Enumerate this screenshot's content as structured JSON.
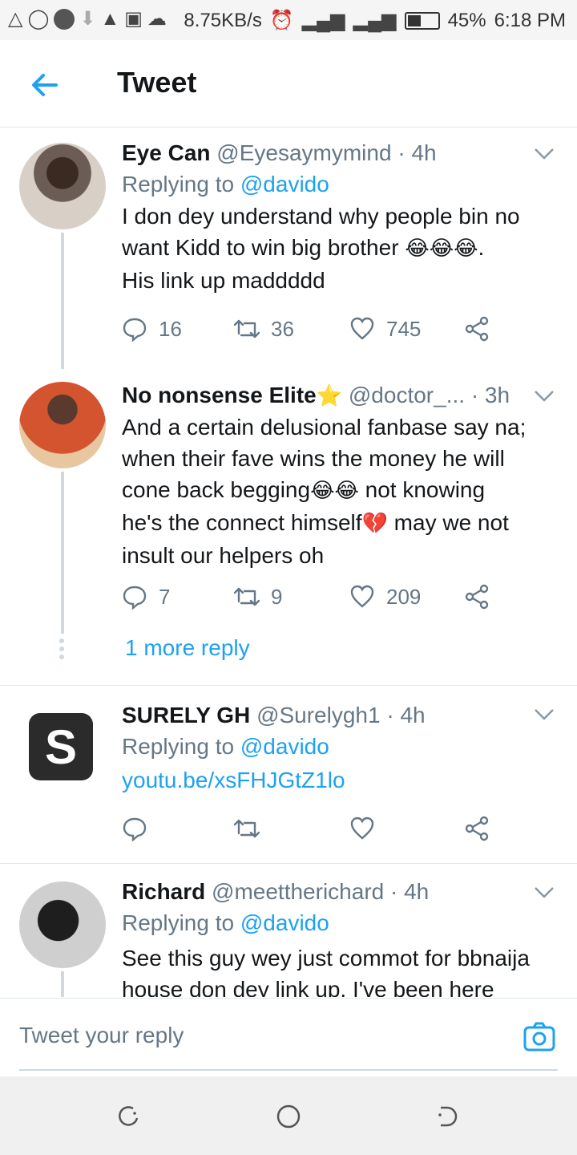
{
  "status_bar": {
    "speed": "8.75KB/s",
    "battery": "45%",
    "time": "6:18 PM",
    "icons": [
      "warning-triangle-icon",
      "whatsapp-icon",
      "dot-icon",
      "download-icon",
      "alert-icon",
      "image-icon",
      "cloud-icon",
      "alarm-icon",
      "signal-icon",
      "wifi-icon",
      "battery-icon"
    ]
  },
  "header": {
    "title": "Tweet",
    "back_icon": "back-arrow-icon"
  },
  "tweets": [
    {
      "name": "Eye Can",
      "handle": "@Eyesaymymind",
      "time": "4h",
      "replying_prefix": "Replying to",
      "replying_to": "@davido",
      "text_line1": "I don dey understand why people bin no",
      "text_line2": "want Kidd to win big brother",
      "emoji2": "😂😂😂",
      "text_line2_end": ".",
      "text_line3": "His link up maddddd",
      "replies": "16",
      "retweets": "36",
      "likes": "745"
    },
    {
      "name": "No nonsense Elite",
      "star": "⭐",
      "handle": "@doctor_...",
      "time": "3h",
      "text_line1": "And a certain delusional fanbase say na;",
      "text_line2": "when their fave wins the money he will",
      "text_line3": "cone back begging",
      "emoji3": "😂😂",
      "text_line3_end": " not knowing",
      "text_line4": "he's the connect himself",
      "emoji4": "💔",
      "text_line4_end": " may we not",
      "text_line5": "insult our helpers oh",
      "replies": "7",
      "retweets": "9",
      "likes": "209",
      "more_reply": "1 more reply"
    },
    {
      "name": "SURELY GH",
      "handle": "@Surelygh1",
      "time": "4h",
      "replying_prefix": "Replying to",
      "replying_to": "@davido",
      "link": "youtu.be/xsFHJGtZ1lo",
      "avatar_letter": "S"
    },
    {
      "name": "Richard",
      "handle": "@meettherichard",
      "time": "4h",
      "replying_prefix": "Replying to",
      "replying_to": "@davido",
      "text_line1": "See this guy wey just commot for bbnaija",
      "text_line2": "house don dey link up. I've been here"
    }
  ],
  "composer": {
    "placeholder": "Tweet your reply",
    "camera_icon": "camera-icon"
  },
  "colors": {
    "accent": "#1da1f2",
    "secondary": "#657786",
    "divider": "#e1e8ed"
  }
}
